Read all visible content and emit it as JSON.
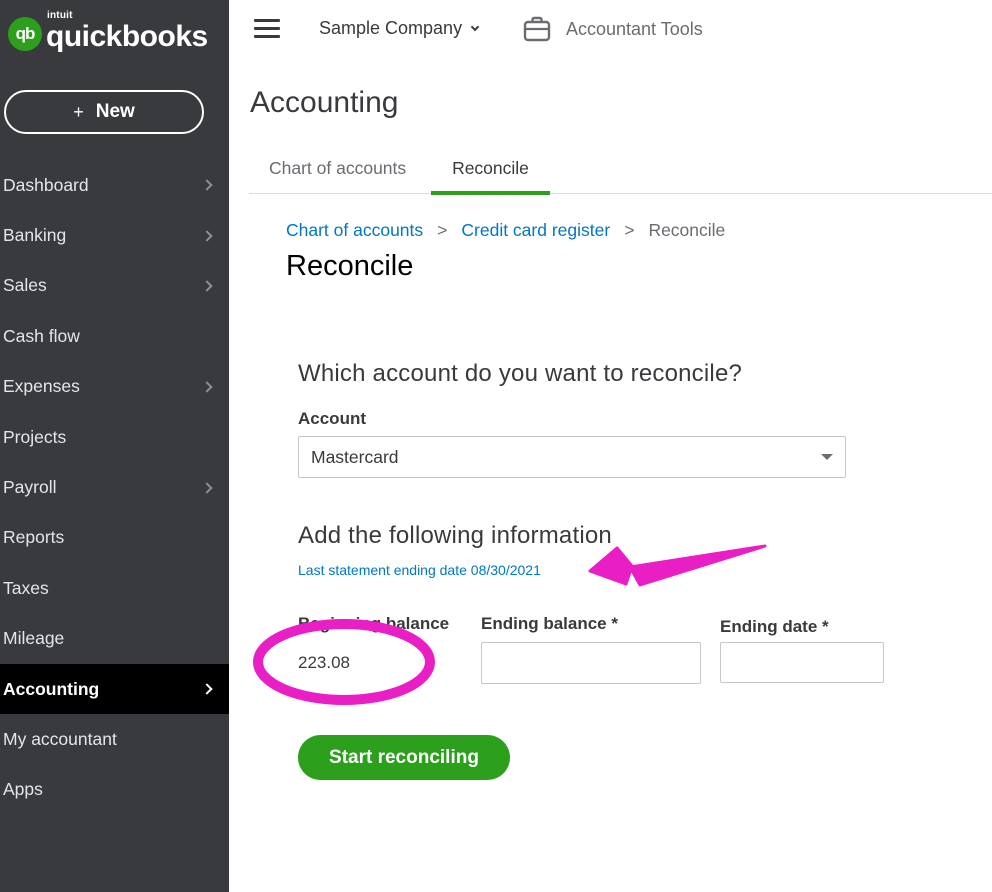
{
  "brand": {
    "mark": "qb",
    "intuit": "intuit",
    "word": "quickbooks"
  },
  "sidebar": {
    "new_button": {
      "plus": "+",
      "label": "New"
    },
    "items": [
      {
        "label": "Dashboard",
        "chevron": true
      },
      {
        "label": "Banking",
        "chevron": true
      },
      {
        "label": "Sales",
        "chevron": true
      },
      {
        "label": "Cash flow",
        "chevron": false
      },
      {
        "label": "Expenses",
        "chevron": true
      },
      {
        "label": "Projects",
        "chevron": false
      },
      {
        "label": "Payroll",
        "chevron": true
      },
      {
        "label": "Reports",
        "chevron": false
      },
      {
        "label": "Taxes",
        "chevron": false
      },
      {
        "label": "Mileage",
        "chevron": false
      },
      {
        "label": "Accounting",
        "chevron": true,
        "active": true
      },
      {
        "label": "My accountant",
        "chevron": false
      },
      {
        "label": "Apps",
        "chevron": false
      }
    ]
  },
  "header": {
    "company": "Sample Company",
    "accountant_tools": "Accountant Tools",
    "page_title": "Accounting"
  },
  "tabs": [
    {
      "label": "Chart of accounts",
      "active": false
    },
    {
      "label": "Reconcile",
      "active": true
    }
  ],
  "breadcrumb": {
    "items": [
      "Chart of accounts",
      "Credit card register"
    ],
    "separator": ">",
    "current": "Reconcile"
  },
  "reconcile": {
    "title": "Reconcile",
    "question": "Which account do you want to reconcile?",
    "account_label": "Account",
    "account_value": "Mastercard",
    "add_info_heading": "Add the following information",
    "last_statement": "Last statement ending date 08/30/2021",
    "beginning_balance_label": "Beginning balance",
    "beginning_balance_value": "223.08",
    "ending_balance_label": "Ending balance *",
    "ending_date_label": "Ending date *",
    "start_button": "Start reconciling"
  },
  "annotations": {
    "color": "#e91ec4"
  },
  "colors": {
    "sidebar": "#393a3d",
    "accent_green": "#2ca01c",
    "link_blue": "#0077c5"
  }
}
